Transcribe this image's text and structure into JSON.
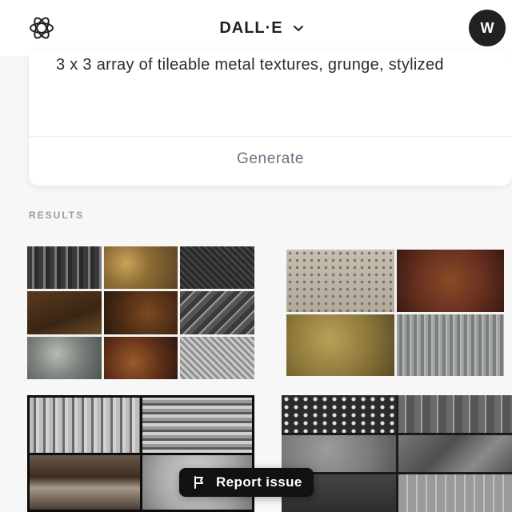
{
  "header": {
    "title": "DALL·E",
    "user_initial": "W"
  },
  "prompt": {
    "text": "3 x 3 array of tileable metal textures, grunge, stylized",
    "generate_label": "Generate"
  },
  "results": {
    "label": "RESULTS"
  },
  "report": {
    "label": "Report issue"
  },
  "colors": {
    "background": "#f7f7f8",
    "avatar_bg": "#202123",
    "report_bg": "#111111"
  }
}
